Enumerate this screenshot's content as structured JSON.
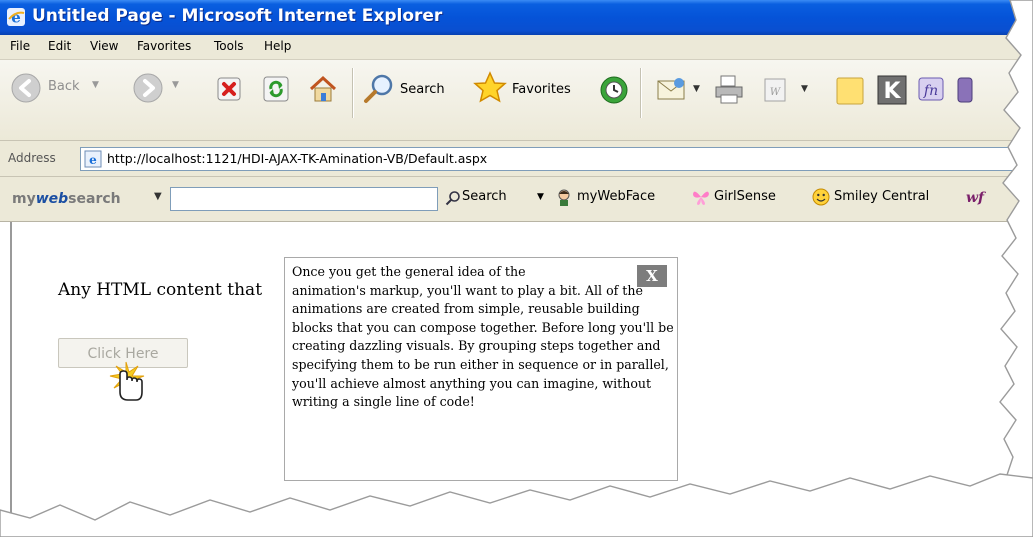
{
  "window": {
    "title": "Untitled Page - Microsoft Internet Explorer"
  },
  "menu": [
    "File",
    "Edit",
    "View",
    "Favorites",
    "Tools",
    "Help"
  ],
  "toolbar": {
    "back_label": "Back",
    "search_label": "Search",
    "favorites_label": "Favorites"
  },
  "address": {
    "label": "Address",
    "url": "http://localhost:1121/HDI-AJAX-TK-Amination-VB/Default.aspx"
  },
  "search_toolbar": {
    "brand_my": "my",
    "brand_web": "web",
    "brand_search": "search",
    "search_value": "",
    "search_button": "Search",
    "links": [
      "myWebFace",
      "GirlSense",
      "Smiley Central"
    ]
  },
  "content": {
    "intro_text": "Any HTML content that",
    "button_label": "Click Here",
    "popup": {
      "close_label": "X",
      "first_line": "Once you get the general idea of the",
      "rest_text": "animation's markup, you'll want to play a bit. All of the animations are created from simple, reusable building blocks that you can compose together. Before long you'll be creating dazzling visuals. By grouping steps together and specifying them to be run either in sequence or in parallel, you'll achieve almost anything you can imagine, without writing a single line of code!"
    }
  },
  "colors": {
    "titlebar_blue": "#0553d8",
    "chrome_beige": "#ece9d8",
    "popup_close_gray": "#7d7d7d"
  }
}
